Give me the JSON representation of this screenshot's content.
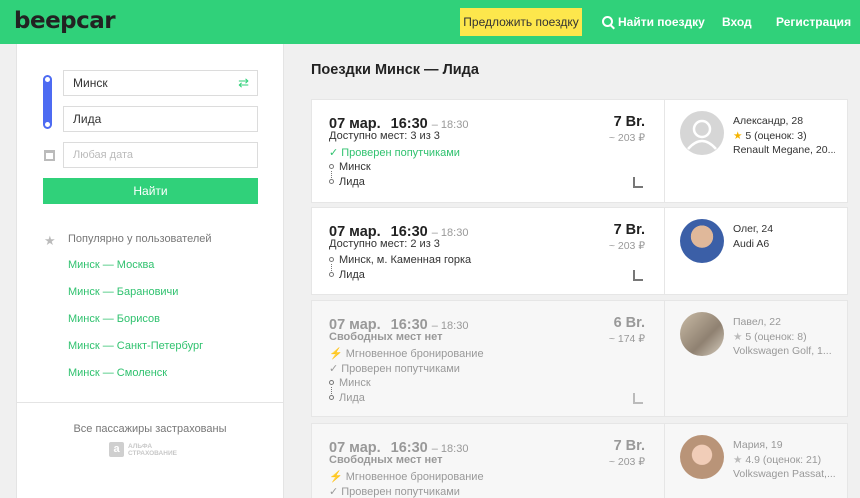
{
  "header": {
    "logo": "beepcar",
    "offer_button": "Предложить поездку",
    "search_link": "Найти поездку",
    "login": "Вход",
    "register": "Регистрация"
  },
  "search": {
    "from": "Минск",
    "to": "Лида",
    "date_placeholder": "Любая дата",
    "find_button": "Найти"
  },
  "popular": {
    "label": "Популярно у пользователей",
    "routes": [
      "Минск — Москва",
      "Минск — Барановичи",
      "Минск — Борисов",
      "Минск — Санкт-Петербург",
      "Минск — Смоленск"
    ]
  },
  "insurance": {
    "text": "Все пассажиры застрахованы",
    "logo_line1": "АЛЬФА",
    "logo_line2": "СТРАХОВАНИЕ"
  },
  "page_title": "Поездки Минск — Лида",
  "trips": [
    {
      "date": "07 мар.",
      "time": "16:30",
      "arrival": "– 18:30",
      "seats": "Доступно мест: 3 из 3",
      "features": [
        "✓ Проверен попутчиками"
      ],
      "from": "Минск",
      "to": "Лида",
      "price": "7 Br.",
      "approx": "~ 203 ₽",
      "driver": {
        "name": "Александр, 28",
        "rating": "5 (оценок: 3)",
        "car": "Renault Megane, 20..."
      }
    },
    {
      "date": "07 мар.",
      "time": "16:30",
      "arrival": "– 18:30",
      "seats": "Доступно мест: 2 из 3",
      "features": [],
      "from": "Минск, м. Каменная горка",
      "to": "Лида",
      "price": "7 Br.",
      "approx": "~ 203 ₽",
      "driver": {
        "name": "Олег, 24",
        "rating": "",
        "car": "Audi A6"
      }
    },
    {
      "date": "07 мар.",
      "time": "16:30",
      "arrival": "– 18:30",
      "seats": "Свободных мест нет",
      "features": [
        "⚡ Мгновенное бронирование",
        "✓ Проверен попутчиками"
      ],
      "from": "Минск",
      "to": "Лида",
      "price": "6 Br.",
      "approx": "~ 174 ₽",
      "driver": {
        "name": "Павел, 22",
        "rating": "5 (оценок: 8)",
        "car": "Volkswagen Golf, 1..."
      }
    },
    {
      "date": "07 мар.",
      "time": "16:30",
      "arrival": "– 18:30",
      "seats": "Свободных мест нет",
      "features": [
        "⚡ Мгновенное бронирование",
        "✓ Проверен попутчиками"
      ],
      "from": "",
      "to": "",
      "price": "7 Br.",
      "approx": "~ 203 ₽",
      "driver": {
        "name": "Мария, 19",
        "rating": "4.9 (оценок: 21)",
        "car": "Volkswagen Passat,..."
      }
    }
  ],
  "colors": {
    "brand_green": "#30d17a",
    "offer_yellow": "#fde74c",
    "route_blue": "#4d6bf2",
    "star": "#f5b400"
  },
  "icons": [
    "search-icon",
    "swap-icon",
    "calendar-icon",
    "star-icon",
    "seat-icon",
    "check-icon",
    "lightning-icon"
  ]
}
